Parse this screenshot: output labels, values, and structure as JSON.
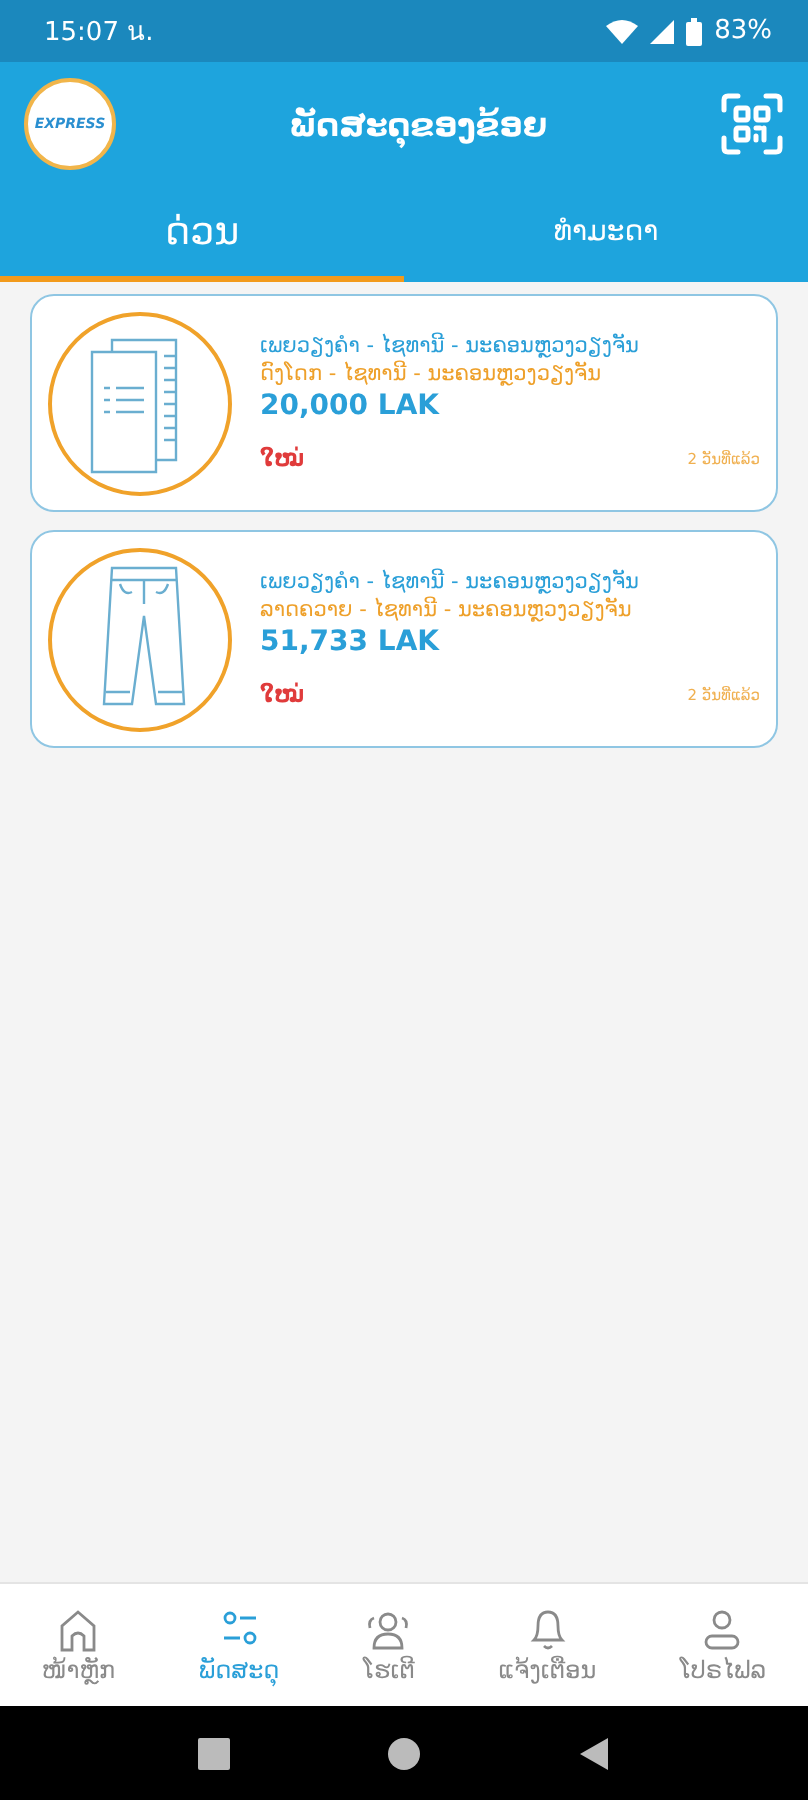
{
  "status_bar": {
    "time": "15:07 น.",
    "battery": "83%"
  },
  "header": {
    "logo_text": "EXPRESS",
    "title": "ພັດສະດຸຂອງຂ້ອຍ"
  },
  "tabs": [
    {
      "label": "ດ່ວນ",
      "selected": true
    },
    {
      "label": "ທຳມະດາ",
      "selected": false
    }
  ],
  "parcels": [
    {
      "kind": "document",
      "from": "ເພຍວຽງຄຳ - ໄຊທານີ - ນະຄອນຫຼວງວຽງຈັນ",
      "to": "ດົງໂດກ - ໄຊທານີ - ນະຄອນຫຼວງວຽງຈັນ",
      "price": "20,000 LAK",
      "status": "ໃໝ່",
      "age": "2 ວັນທີ່ແລ້ວ"
    },
    {
      "kind": "clothing",
      "from": "ເພຍວຽງຄຳ - ໄຊທານີ - ນະຄອນຫຼວງວຽງຈັນ",
      "to": "ລາດຄວາຍ - ໄຊທານີ - ນະຄອນຫຼວງວຽງຈັນ",
      "price": "51,733 LAK",
      "status": "ໃໝ່",
      "age": "2 ວັນທີ່ແລ້ວ"
    }
  ],
  "bottom_nav": [
    {
      "kind": "home",
      "label": "ໜ້າຫຼັກ",
      "selected": false
    },
    {
      "kind": "parcel",
      "label": "ພັດສະດຸ",
      "selected": true
    },
    {
      "kind": "people",
      "label": "ໂຮເຕີ",
      "selected": false
    },
    {
      "kind": "bell",
      "label": "ແຈ້ງເຕືອນ",
      "selected": false
    },
    {
      "kind": "profile",
      "label": "ໂປຣໄຟລ",
      "selected": false
    }
  ]
}
